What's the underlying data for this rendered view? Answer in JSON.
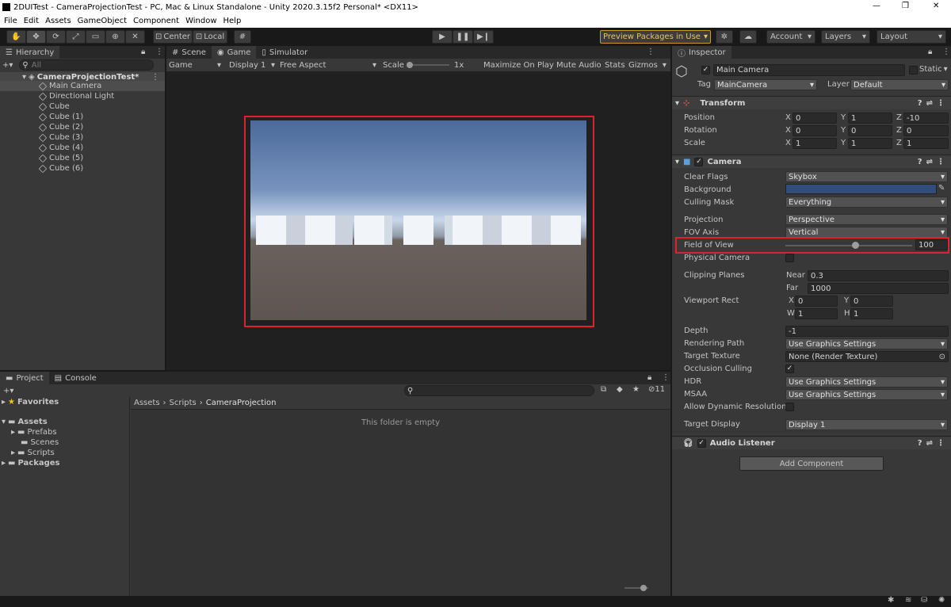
{
  "window": {
    "title": "2DUITest - CameraProjectionTest - PC, Mac & Linux Standalone - Unity 2020.3.15f2 Personal* <DX11>",
    "minimize": "—",
    "maximize": "❐",
    "close": "✕"
  },
  "menu": [
    "File",
    "Edit",
    "Assets",
    "GameObject",
    "Component",
    "Window",
    "Help"
  ],
  "toolbar": {
    "center": "Center",
    "local": "Local",
    "preview_packages": "Preview Packages in Use",
    "account": "Account",
    "layers": "Layers",
    "layout": "Layout"
  },
  "hierarchy": {
    "tab": "Hierarchy",
    "search_placeholder": "All",
    "scene": "CameraProjectionTest*",
    "items": [
      "Main Camera",
      "Directional Light",
      "Cube",
      "Cube (1)",
      "Cube (2)",
      "Cube (3)",
      "Cube (4)",
      "Cube (5)",
      "Cube (6)"
    ]
  },
  "game_view": {
    "tabs": [
      "Scene",
      "Game",
      "Simulator"
    ],
    "mode": "Game",
    "display": "Display 1",
    "aspect": "Free Aspect",
    "scale_label": "Scale",
    "scale_value": "1x",
    "maximize": "Maximize On Play",
    "mute": "Mute Audio",
    "stats": "Stats",
    "gizmos": "Gizmos"
  },
  "project": {
    "tabs": [
      "Project",
      "Console"
    ],
    "favorites": "Favorites",
    "assets": "Assets",
    "folders": [
      "Prefabs",
      "Scenes",
      "Scripts"
    ],
    "packages": "Packages",
    "breadcrumb": [
      "Assets",
      "Scripts",
      "CameraProjection"
    ],
    "empty": "This folder is empty",
    "hidden_count": "11"
  },
  "inspector": {
    "tab": "Inspector",
    "name": "Main Camera",
    "static": "Static",
    "tag_label": "Tag",
    "tag": "MainCamera",
    "layer_label": "Layer",
    "layer": "Default",
    "transform": {
      "title": "Transform",
      "rows": [
        {
          "label": "Position",
          "x": "0",
          "y": "1",
          "z": "-10"
        },
        {
          "label": "Rotation",
          "x": "0",
          "y": "0",
          "z": "0"
        },
        {
          "label": "Scale",
          "x": "1",
          "y": "1",
          "z": "1"
        }
      ]
    },
    "camera": {
      "title": "Camera",
      "clear_flags_label": "Clear Flags",
      "clear_flags": "Skybox",
      "background_label": "Background",
      "background_color": "#314d79",
      "culling_label": "Culling Mask",
      "culling": "Everything",
      "projection_label": "Projection",
      "projection": "Perspective",
      "fov_axis_label": "FOV Axis",
      "fov_axis": "Vertical",
      "fov_label": "Field of View",
      "fov": "100",
      "fov_fraction": 0.55,
      "physical_label": "Physical Camera",
      "clipping_label": "Clipping Planes",
      "near_label": "Near",
      "near": "0.3",
      "far_label": "Far",
      "far": "1000",
      "viewport_label": "Viewport Rect",
      "vx": "0",
      "vy": "0",
      "vw": "1",
      "vh": "1",
      "depth_label": "Depth",
      "depth": "-1",
      "rendering_label": "Rendering Path",
      "rendering": "Use Graphics Settings",
      "target_texture_label": "Target Texture",
      "target_texture": "None (Render Texture)",
      "occlusion_label": "Occlusion Culling",
      "hdr_label": "HDR",
      "hdr": "Use Graphics Settings",
      "msaa_label": "MSAA",
      "msaa": "Use Graphics Settings",
      "dynamic_label": "Allow Dynamic Resolution",
      "target_display_label": "Target Display",
      "target_display": "Display 1"
    },
    "audio_listener": "Audio Listener",
    "add_component": "Add Component"
  },
  "colors": {
    "highlight": "#e0202a",
    "accent": "#3a79bb"
  }
}
